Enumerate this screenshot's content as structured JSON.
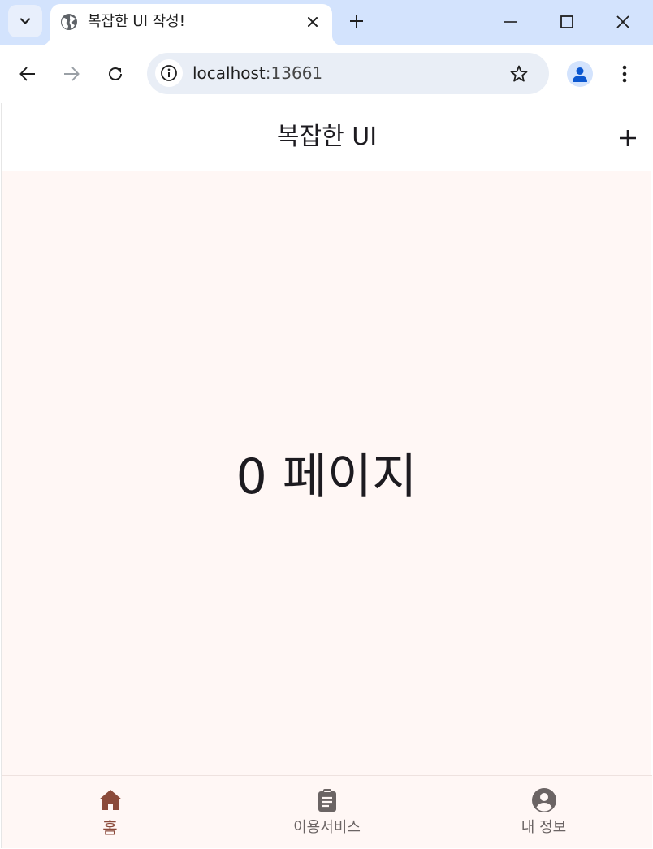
{
  "browser": {
    "tab": {
      "title": "복잡한 UI 작성!"
    },
    "url": {
      "host": "localhost",
      "port": ":13661"
    }
  },
  "app": {
    "title": "복잡한 UI",
    "page_label": "0 페이지",
    "bottom_nav": [
      {
        "label": "홈",
        "icon": "home-icon",
        "active": true
      },
      {
        "label": "이용서비스",
        "icon": "clipboard-icon",
        "active": false
      },
      {
        "label": "내 정보",
        "icon": "account-circle-icon",
        "active": false
      }
    ]
  },
  "colors": {
    "tabstrip": "#d3e3fd",
    "app_background": "#fff7f5",
    "active_nav": "#8b4a3a",
    "inactive_nav": "#6b6464"
  }
}
